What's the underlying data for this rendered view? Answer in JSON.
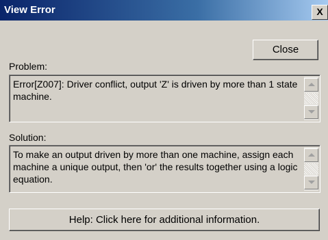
{
  "window": {
    "title": "View Error",
    "close_glyph": "X"
  },
  "buttons": {
    "close_label": "Close",
    "help_label": "Help:  Click here for additional information."
  },
  "problem": {
    "label": "Problem:",
    "text": "Error[Z007]: Driver conflict, output 'Z' is driven by more than 1 state machine."
  },
  "solution": {
    "label": "Solution:",
    "text": "To make an output driven by more than one machine, assign each machine a unique output, then 'or' the results together using a logic equation."
  },
  "colors": {
    "face": "#d4d0c8",
    "title_start": "#0a246a",
    "title_end": "#a6caf0"
  },
  "icons": {
    "title_close": "close-icon",
    "scroll_up": "scroll-up-arrow-icon",
    "scroll_down": "scroll-down-arrow-icon"
  }
}
